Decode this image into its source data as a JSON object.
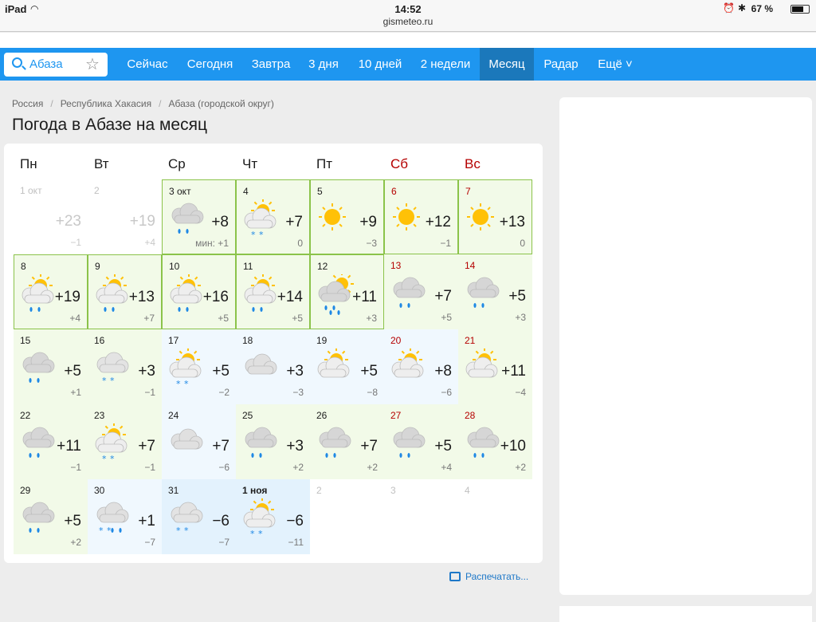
{
  "status_bar": {
    "device": "iPad",
    "time": "14:52",
    "url": "gismeteo.ru",
    "battery": "67 %"
  },
  "nav": {
    "search_value": "Абаза",
    "items": [
      {
        "label": "Сейчас",
        "active": false
      },
      {
        "label": "Сегодня",
        "active": false
      },
      {
        "label": "Завтра",
        "active": false
      },
      {
        "label": "3 дня",
        "active": false
      },
      {
        "label": "10 дней",
        "active": false
      },
      {
        "label": "2 недели",
        "active": false
      },
      {
        "label": "Месяц",
        "active": true
      },
      {
        "label": "Радар",
        "active": false
      },
      {
        "label": "Ещё",
        "active": false
      }
    ]
  },
  "breadcrumbs": [
    "Россия",
    "Республика Хакасия",
    "Абаза (городской округ)"
  ],
  "page_title": "Погода в Абазе на месяц",
  "weekdays": [
    {
      "label": "Пн",
      "weekend": false
    },
    {
      "label": "Вт",
      "weekend": false
    },
    {
      "label": "Ср",
      "weekend": false
    },
    {
      "label": "Чт",
      "weekend": false
    },
    {
      "label": "Пт",
      "weekend": false
    },
    {
      "label": "Сб",
      "weekend": true
    },
    {
      "label": "Вс",
      "weekend": true
    }
  ],
  "min_label": "мин: +1",
  "colors": {
    "nav": "#1e96f0",
    "nav_active": "#1b78bb",
    "weekend": "#b50000",
    "range_border": "#8bc34a",
    "warm_bg": "#f2fae8",
    "cold_bg": "#f0f8fe",
    "frost_bg": "#e3f2fd"
  },
  "days": [
    {
      "date": "1 окт",
      "hi": "+23",
      "lo": "−1",
      "past": true,
      "icon": "none"
    },
    {
      "date": "2",
      "hi": "+19",
      "lo": "+4",
      "past": true,
      "icon": "none"
    },
    {
      "date": "3 окт",
      "hi": "+8",
      "lo": "мин: +1",
      "icon": "cloud-rain",
      "bg": "warm",
      "box": true
    },
    {
      "date": "4",
      "hi": "+7",
      "lo": "0",
      "icon": "partly-snow",
      "bg": "warm",
      "box": true
    },
    {
      "date": "5",
      "hi": "+9",
      "lo": "−3",
      "icon": "sun",
      "bg": "warm",
      "box": true
    },
    {
      "date": "6",
      "hi": "+12",
      "lo": "−1",
      "icon": "sun",
      "bg": "warm",
      "box": true,
      "weekend": true
    },
    {
      "date": "7",
      "hi": "+13",
      "lo": "0",
      "icon": "sun",
      "bg": "warm",
      "box": true,
      "weekend": true
    },
    {
      "date": "8",
      "hi": "+19",
      "lo": "+4",
      "icon": "partly-rain",
      "bg": "warm",
      "box": true
    },
    {
      "date": "9",
      "hi": "+13",
      "lo": "+7",
      "icon": "partly-rain",
      "bg": "warm",
      "box": true
    },
    {
      "date": "10",
      "hi": "+16",
      "lo": "+5",
      "icon": "partly-rain",
      "bg": "warm",
      "box": true
    },
    {
      "date": "11",
      "hi": "+14",
      "lo": "+5",
      "icon": "partly-rain",
      "bg": "warm",
      "box": true
    },
    {
      "date": "12",
      "hi": "+11",
      "lo": "+3",
      "icon": "partly-cloud-rain",
      "bg": "warm",
      "box": true
    },
    {
      "date": "13",
      "hi": "+7",
      "lo": "+5",
      "icon": "cloud-rain",
      "bg": "warm",
      "weekend": true
    },
    {
      "date": "14",
      "hi": "+5",
      "lo": "+3",
      "icon": "cloud-rain",
      "bg": "warm",
      "weekend": true
    },
    {
      "date": "15",
      "hi": "+5",
      "lo": "+1",
      "icon": "cloud-rain",
      "bg": "warm"
    },
    {
      "date": "16",
      "hi": "+3",
      "lo": "−1",
      "icon": "cloud-snow",
      "bg": "warm"
    },
    {
      "date": "17",
      "hi": "+5",
      "lo": "−2",
      "icon": "partly-snow",
      "bg": "cold"
    },
    {
      "date": "18",
      "hi": "+3",
      "lo": "−3",
      "icon": "cloud",
      "bg": "cold"
    },
    {
      "date": "19",
      "hi": "+5",
      "lo": "−8",
      "icon": "partly",
      "bg": "cold"
    },
    {
      "date": "20",
      "hi": "+8",
      "lo": "−6",
      "icon": "partly",
      "bg": "cold",
      "weekend": true
    },
    {
      "date": "21",
      "hi": "+11",
      "lo": "−4",
      "icon": "partly",
      "bg": "warm",
      "weekend": true
    },
    {
      "date": "22",
      "hi": "+11",
      "lo": "−1",
      "icon": "cloud-rain",
      "bg": "warm"
    },
    {
      "date": "23",
      "hi": "+7",
      "lo": "−1",
      "icon": "partly-snow",
      "bg": "warm"
    },
    {
      "date": "24",
      "hi": "+7",
      "lo": "−6",
      "icon": "cloud",
      "bg": "cold"
    },
    {
      "date": "25",
      "hi": "+3",
      "lo": "+2",
      "icon": "cloud-rain",
      "bg": "warm"
    },
    {
      "date": "26",
      "hi": "+7",
      "lo": "+2",
      "icon": "cloud-rain",
      "bg": "warm"
    },
    {
      "date": "27",
      "hi": "+5",
      "lo": "+4",
      "icon": "cloud-rain",
      "bg": "warm",
      "weekend": true
    },
    {
      "date": "28",
      "hi": "+10",
      "lo": "+2",
      "icon": "cloud-rain",
      "bg": "warm",
      "weekend": true
    },
    {
      "date": "29",
      "hi": "+5",
      "lo": "+2",
      "icon": "cloud-rain",
      "bg": "warm"
    },
    {
      "date": "30",
      "hi": "+1",
      "lo": "−7",
      "icon": "cloud-mixed",
      "bg": "cold"
    },
    {
      "date": "31",
      "hi": "−6",
      "lo": "−7",
      "icon": "cloud-snow",
      "bg": "frost"
    },
    {
      "date": "1 ноя",
      "hi": "−6",
      "lo": "−11",
      "icon": "partly-snow",
      "bg": "frost",
      "bold": true
    },
    {
      "date": "2",
      "hi": "",
      "lo": "",
      "past": true,
      "icon": "none"
    },
    {
      "date": "3",
      "hi": "",
      "lo": "",
      "past": true,
      "icon": "none"
    },
    {
      "date": "4",
      "hi": "",
      "lo": "",
      "past": true,
      "icon": "none"
    }
  ],
  "print_label": "Распечатать..."
}
